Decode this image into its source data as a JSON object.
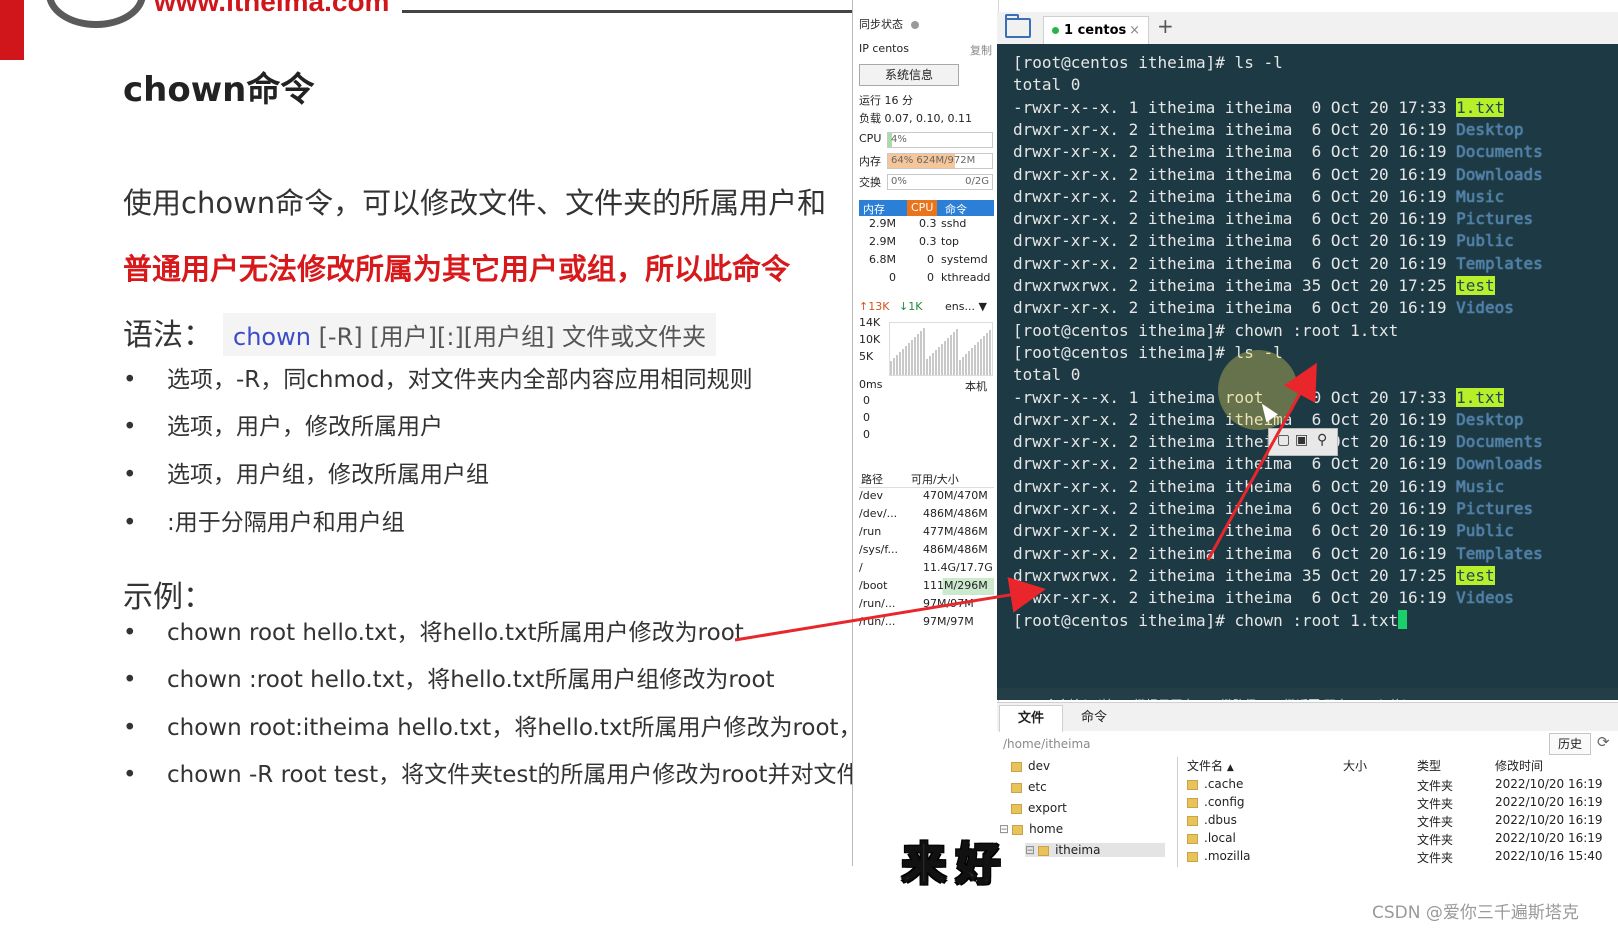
{
  "slide": {
    "site_url": "www.itheima.com",
    "title": "chown命令",
    "intro": "使用chown命令，可以修改文件、文件夹的所属用户和",
    "warning": "普通用户无法修改所属为其它用户或组，所以此命令",
    "syntax_label": "语法：",
    "syntax_cmd": "chown",
    "syntax_args": " [-R] [用户][:][用户组] 文件或文件夹",
    "options": [
      "选项，-R，同chmod，对文件夹内全部内容应用相同规则",
      "选项，用户，修改所属用户",
      "选项，用户组，修改所属用户组",
      ":用于分隔用户和用户组"
    ],
    "example_label": "示例：",
    "examples": [
      "chown root hello.txt，将hello.txt所属用户修改为root",
      "chown :root hello.txt，将hello.txt所属用户组修改为root",
      "chown root:itheima hello.txt，将hello.txt所属用户修改为root，",
      "chown -R root test，将文件夹test的所属用户修改为root并对文件"
    ]
  },
  "monitor": {
    "sync_label": "同步状态",
    "ip_label": "IP centos",
    "copy_label": "复制",
    "sysinfo_button": "系统信息",
    "uptime": "运行 16 分",
    "load": "负载 0.07, 0.10, 0.11",
    "cpu_label": "CPU",
    "cpu_value": "4%",
    "cpu_fraction": 0.04,
    "mem_label": "内存",
    "mem_value": "64% 624M/972M",
    "mem_fraction": 0.64,
    "swap_label": "交换",
    "swap_value": "0%",
    "swap_total": "0/2G",
    "swap_fraction": 0.0,
    "proc_headers": [
      "内存",
      "CPU",
      "命令"
    ],
    "processes": [
      {
        "mem": "2.9M",
        "cpu": "0.3",
        "cmd": "sshd"
      },
      {
        "mem": "2.9M",
        "cpu": "0.3",
        "cmd": "top"
      },
      {
        "mem": "6.8M",
        "cpu": "0",
        "cmd": "systemd"
      },
      {
        "mem": "0",
        "cpu": "0",
        "cmd": "kthreadd"
      }
    ],
    "net_up": "↑13K",
    "net_down": "↓1K",
    "net_iface": "ens...",
    "net_scale": [
      "14K",
      "10K",
      "5K"
    ],
    "latency_label": "0ms",
    "latency_host": "本机",
    "latency_values": [
      "0",
      "0",
      "0"
    ],
    "disk_headers": [
      "路径",
      "可用/大小"
    ],
    "disks": [
      {
        "path": "/dev",
        "size": "470M/470M"
      },
      {
        "path": "/dev/...",
        "size": "486M/486M"
      },
      {
        "path": "/run",
        "size": "477M/486M"
      },
      {
        "path": "/sys/f...",
        "size": "486M/486M"
      },
      {
        "path": "/",
        "size": "11.4G/17.7G"
      },
      {
        "path": "/boot",
        "size": "111M/296M"
      },
      {
        "path": "/run/...",
        "size": "97M/97M"
      },
      {
        "path": "/run/...",
        "size": "97M/97M"
      }
    ]
  },
  "terminal": {
    "tab_label": "1 centos",
    "tab_close": "×",
    "tab_add": "+",
    "prompt_ls": "[root@centos itheima]# ls -l",
    "total": "total 0",
    "prompt_chown": "[root@centos itheima]# chown :root 1.txt",
    "listing1": [
      {
        "pre": "-rwxr-x--x. 1 itheima itheima  0 Oct 20 17:33 ",
        "name": "1.txt",
        "style": "hl"
      },
      {
        "pre": "drwxr-xr-x. 2 itheima itheima  6 Oct 20 16:19 ",
        "name": "Desktop",
        "style": "dir"
      },
      {
        "pre": "drwxr-xr-x. 2 itheima itheima  6 Oct 20 16:19 ",
        "name": "Documents",
        "style": "dir"
      },
      {
        "pre": "drwxr-xr-x. 2 itheima itheima  6 Oct 20 16:19 ",
        "name": "Downloads",
        "style": "dir"
      },
      {
        "pre": "drwxr-xr-x. 2 itheima itheima  6 Oct 20 16:19 ",
        "name": "Music",
        "style": "dir"
      },
      {
        "pre": "drwxr-xr-x. 2 itheima itheima  6 Oct 20 16:19 ",
        "name": "Pictures",
        "style": "dir"
      },
      {
        "pre": "drwxr-xr-x. 2 itheima itheima  6 Oct 20 16:19 ",
        "name": "Public",
        "style": "dir"
      },
      {
        "pre": "drwxr-xr-x. 2 itheima itheima  6 Oct 20 16:19 ",
        "name": "Templates",
        "style": "dir"
      },
      {
        "pre": "drwxrwxrwx. 2 itheima itheima 35 Oct 20 17:25 ",
        "name": "test",
        "style": "hl"
      },
      {
        "pre": "drwxr-xr-x. 2 itheima itheima  6 Oct 20 16:19 ",
        "name": "Videos",
        "style": "dir"
      }
    ],
    "listing2": [
      {
        "pre": "-rwxr-x--x. 1 itheima root     0 Oct 20 17:33 ",
        "name": "1.txt",
        "style": "hl"
      },
      {
        "pre": "drwxr-xr-x. 2 itheima itheima  6 Oct 20 16:19 ",
        "name": "Desktop",
        "style": "dir"
      },
      {
        "pre": "drwxr-xr-x. 2 itheima itheima  6 Oct 20 16:19 ",
        "name": "Documents",
        "style": "dir"
      },
      {
        "pre": "drwxr-xr-x. 2 itheima itheima  6 Oct 20 16:19 ",
        "name": "Downloads",
        "style": "dir"
      },
      {
        "pre": "drwxr-xr-x. 2 itheima itheima  6 Oct 20 16:19 ",
        "name": "Music",
        "style": "dir"
      },
      {
        "pre": "drwxr-xr-x. 2 itheima itheima  6 Oct 20 16:19 ",
        "name": "Pictures",
        "style": "dir"
      },
      {
        "pre": "drwxr-xr-x. 2 itheima itheima  6 Oct 20 16:19 ",
        "name": "Public",
        "style": "dir"
      },
      {
        "pre": "drwxr-xr-x. 2 itheima itheima  6 Oct 20 16:19 ",
        "name": "Templates",
        "style": "dir"
      },
      {
        "pre": "drwxrwxrwx. 2 itheima itheima 35 Oct 20 17:25 ",
        "name": "test",
        "style": "hl"
      },
      {
        "pre": "drwxr-xr-x. 2 itheima itheima  6 Oct 20 16:19 ",
        "name": "Videos",
        "style": "dir"
      }
    ],
    "prompt_last": "[root@centos itheima]# chown :root 1.txt",
    "cmd_hint": "命令输入 (按ALT键提示历史,TAB键路径,ESC键返回,双击CTRL切换)"
  },
  "files": {
    "tab_files": "文件",
    "tab_cmds": "命令",
    "path": "/home/itheima",
    "history_button": "历史",
    "tree": [
      {
        "name": "dev",
        "indent": 0
      },
      {
        "name": "etc",
        "indent": 0
      },
      {
        "name": "export",
        "indent": 0
      },
      {
        "name": "home",
        "indent": 0
      },
      {
        "name": "itheima",
        "indent": 1
      }
    ],
    "columns": [
      "文件名",
      "大小",
      "类型",
      "修改时间"
    ],
    "rows": [
      {
        "name": ".cache",
        "type": "文件夹",
        "mtime": "2022/10/20 16:19"
      },
      {
        "name": ".config",
        "type": "文件夹",
        "mtime": "2022/10/20 16:19"
      },
      {
        "name": ".dbus",
        "type": "文件夹",
        "mtime": "2022/10/20 16:19"
      },
      {
        "name": ".local",
        "type": "文件夹",
        "mtime": "2022/10/20 16:19"
      },
      {
        "name": ".mozilla",
        "type": "文件夹",
        "mtime": "2022/10/16 15:40"
      }
    ]
  },
  "overlay": {
    "subtitle": "来好",
    "watermark": "CSDN @爱你三千遍斯塔克"
  },
  "colors": {
    "accent_red": "#d7191c",
    "terminal_bg": "#1d3a44",
    "highlight_green": "#b7f02a",
    "process_header_blue": "#2b7fd6"
  }
}
